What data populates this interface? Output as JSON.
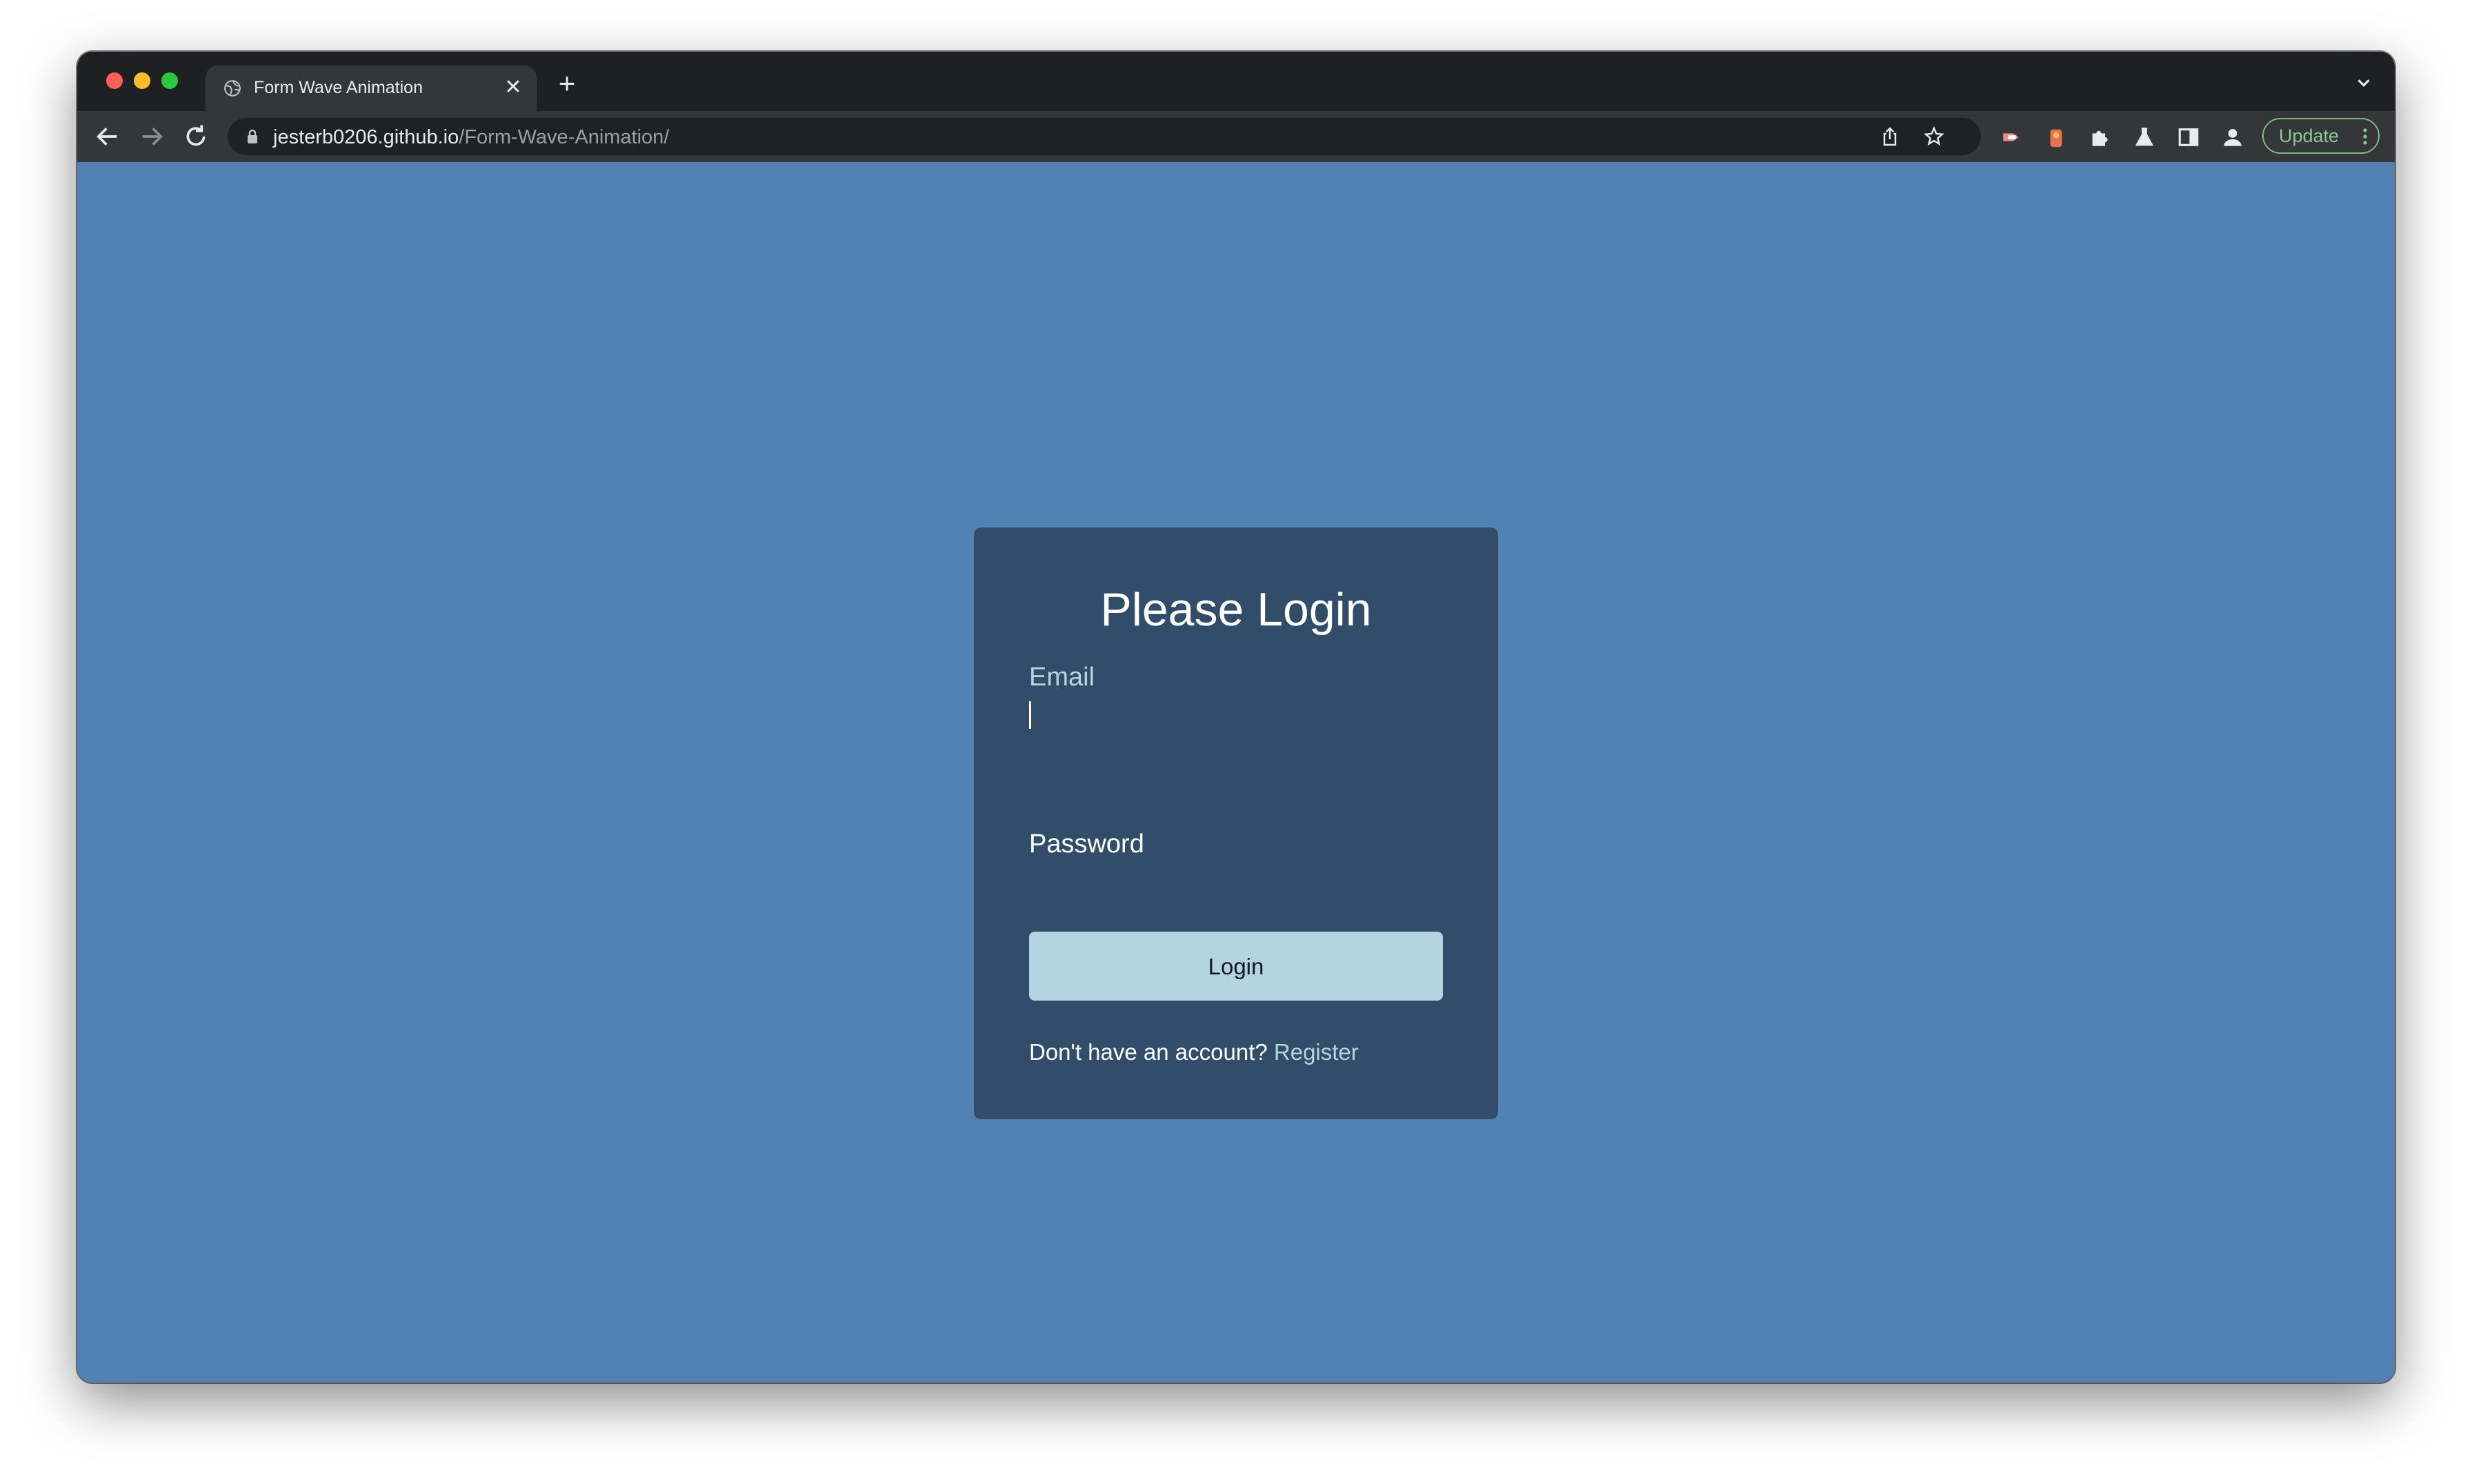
{
  "browser": {
    "tab": {
      "title": "Form Wave Animation"
    },
    "address_bar": {
      "host": "jesterb0206.github.io",
      "path": "/Form-Wave-Animation/"
    },
    "update_label": "Update"
  },
  "colors": {
    "page_background": "#5182b3",
    "card_background": "#324d6a",
    "button_background": "#b3d5e0",
    "link": "#b3d5e0"
  },
  "icons": {
    "tab": [
      "globe-icon",
      "close-icon",
      "plus-icon",
      "chevron-down-icon"
    ],
    "toolbar": [
      "back-arrow-icon",
      "forward-arrow-icon",
      "reload-icon",
      "lock-icon",
      "share-icon",
      "star-icon",
      "extension-icon-1",
      "extension-icon-2",
      "puzzle-icon",
      "labs-icon",
      "side-panel-icon",
      "profile-icon",
      "more-vert-icon"
    ]
  },
  "login_form": {
    "title": "Please Login",
    "email": {
      "label": "Email",
      "value": ""
    },
    "password": {
      "label": "Password",
      "value": ""
    },
    "submit_label": "Login",
    "register_prompt": "Don't have an account?",
    "register_link": "Register"
  }
}
